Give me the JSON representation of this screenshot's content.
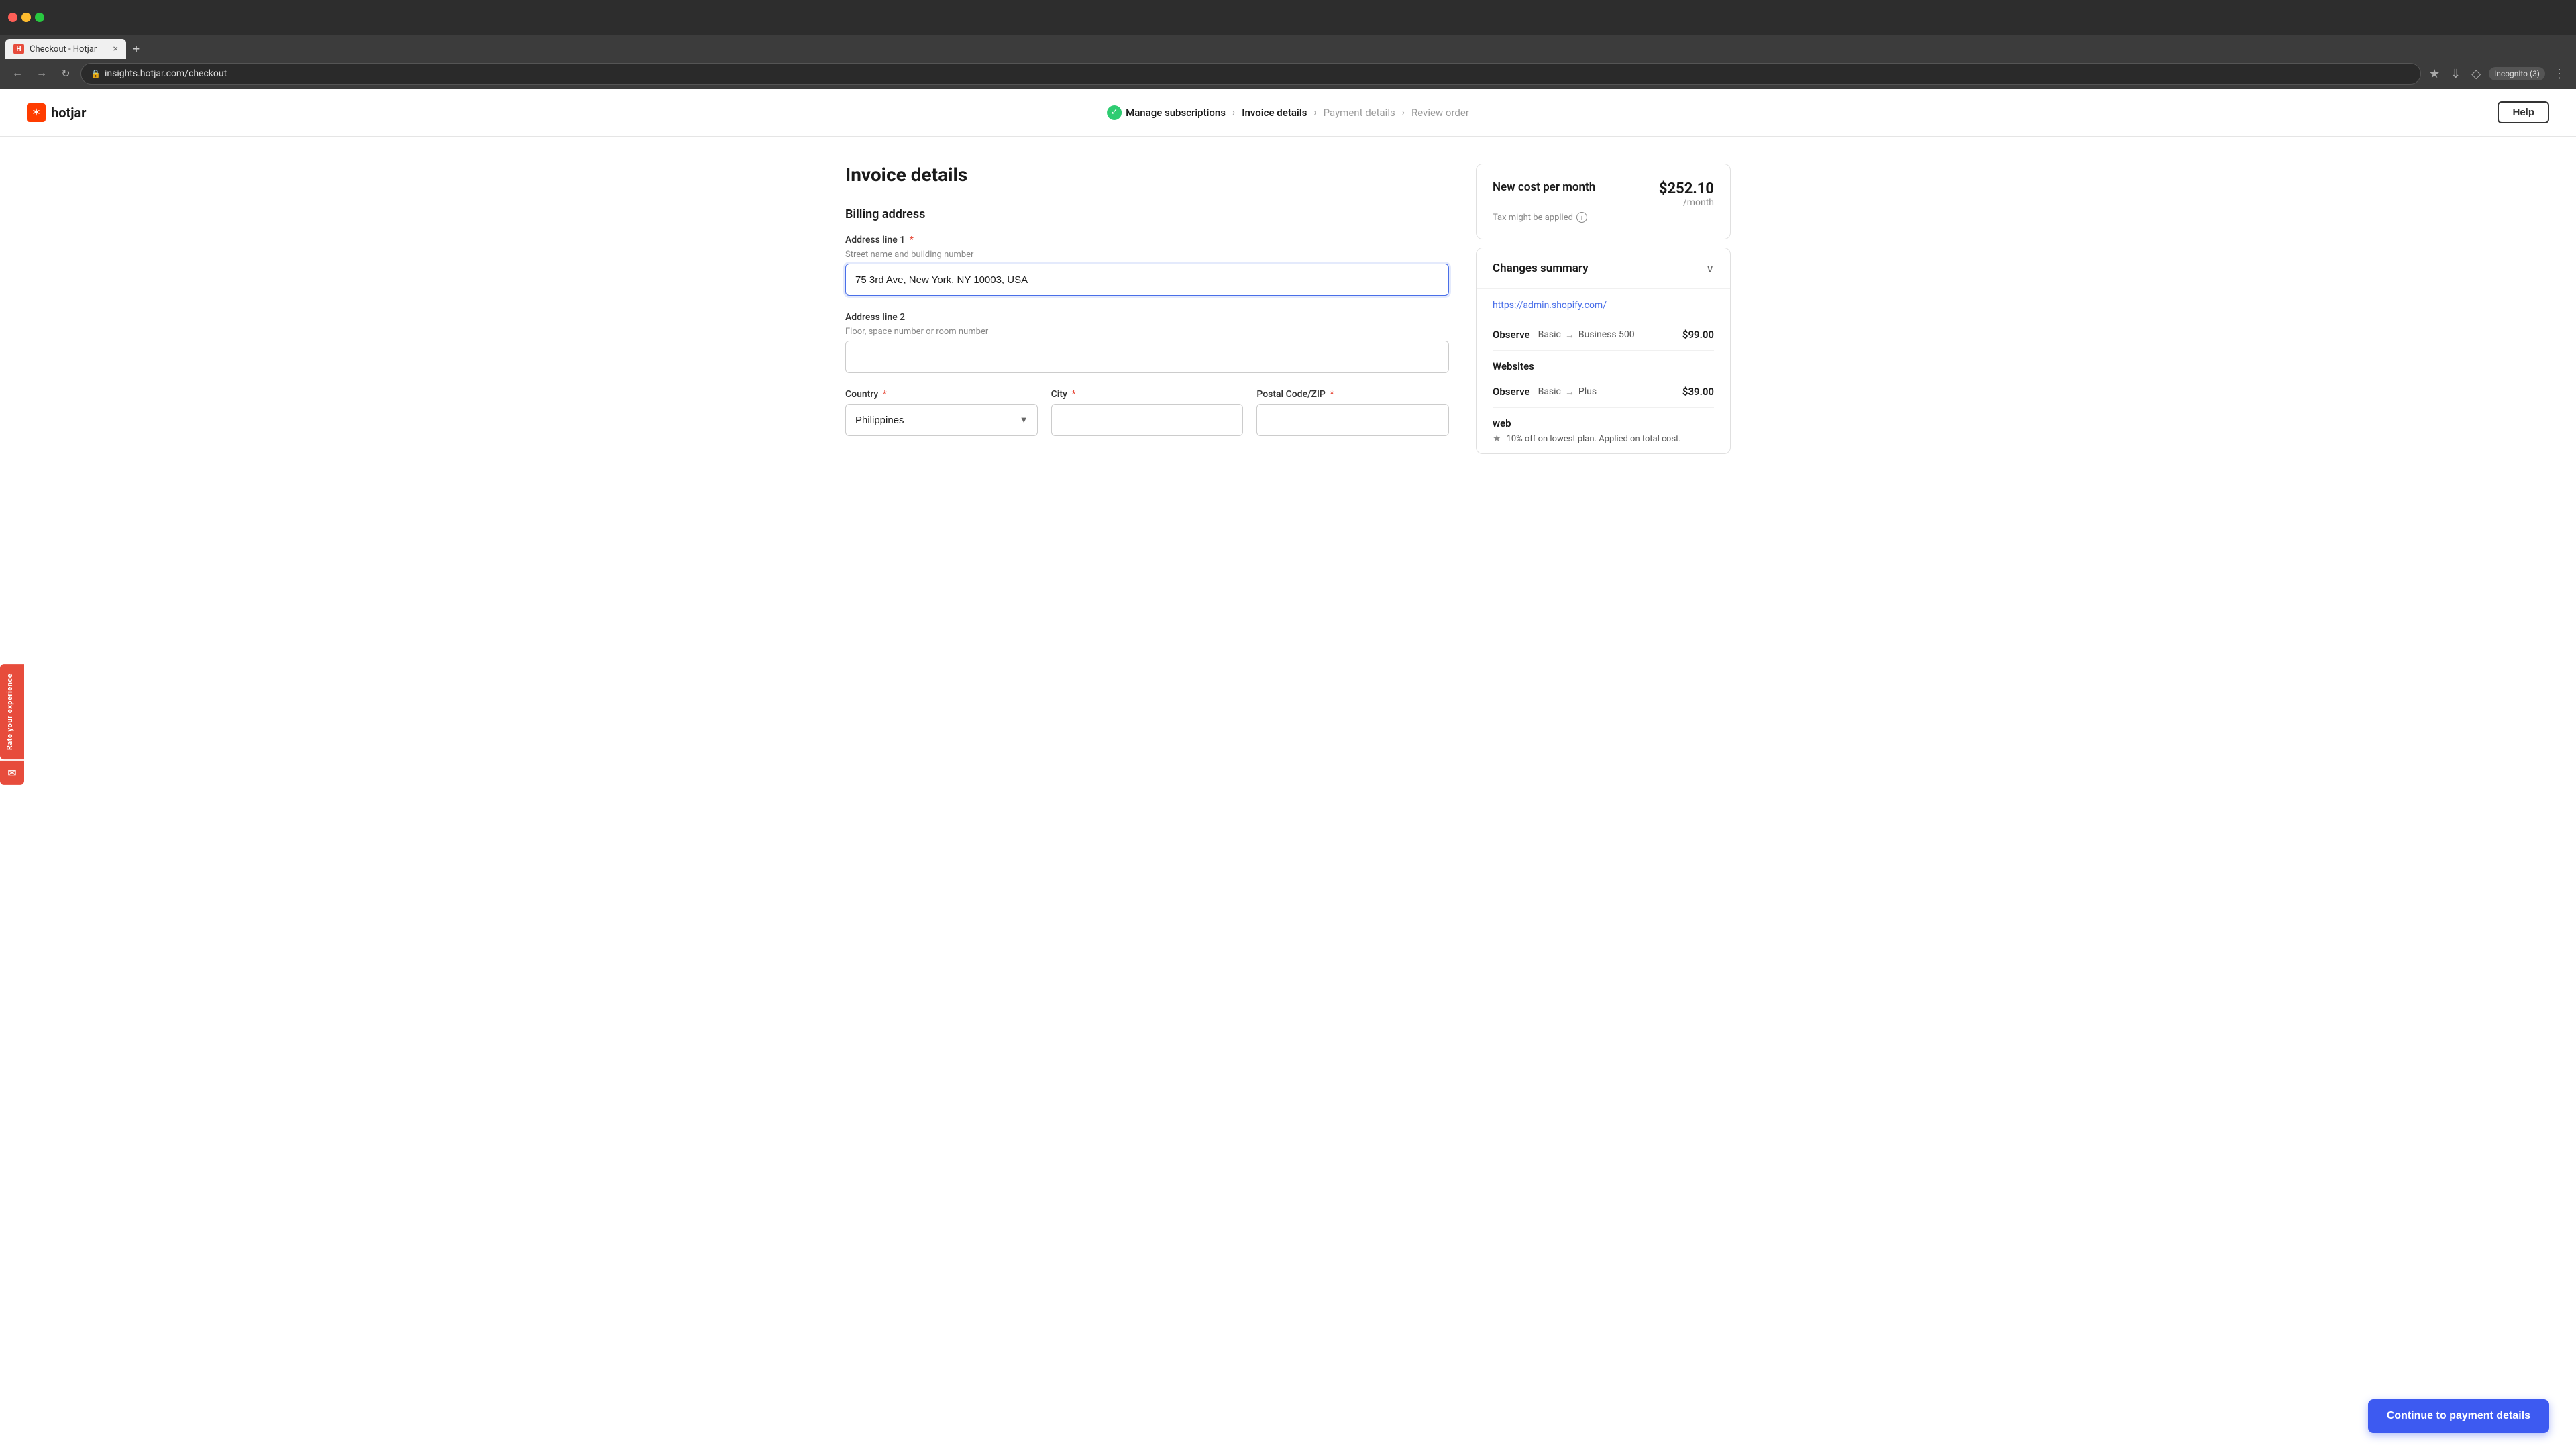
{
  "browser": {
    "tab_favicon": "H",
    "tab_title": "Checkout - Hotjar",
    "tab_close": "×",
    "new_tab": "+",
    "back_btn": "←",
    "forward_btn": "→",
    "refresh_btn": "↻",
    "address_url": "insights.hotjar.com/checkout",
    "incognito_label": "Incognito (3)",
    "window_controls": {
      "min": "_",
      "max": "□",
      "close": "×"
    }
  },
  "header": {
    "logo_text": "hotjar",
    "help_label": "Help",
    "breadcrumbs": [
      {
        "id": "manage",
        "label": "Manage subscriptions",
        "state": "completed"
      },
      {
        "id": "invoice",
        "label": "Invoice details",
        "state": "active"
      },
      {
        "id": "payment",
        "label": "Payment details",
        "state": "inactive"
      },
      {
        "id": "review",
        "label": "Review order",
        "state": "inactive"
      }
    ]
  },
  "page": {
    "title": "Invoice details",
    "billing_section_title": "Billing address",
    "fields": {
      "address1": {
        "label": "Address line 1",
        "hint": "Street name and building number",
        "value": "75 3rd Ave, New York, NY 10003, USA",
        "placeholder": ""
      },
      "address2": {
        "label": "Address line 2",
        "hint": "Floor, space number or room number",
        "value": "",
        "placeholder": ""
      },
      "country": {
        "label": "Country",
        "value": "Philippines"
      },
      "city": {
        "label": "City",
        "value": ""
      },
      "postal": {
        "label": "Postal Code/ZIP",
        "value": ""
      }
    }
  },
  "sidebar": {
    "cost_card": {
      "label": "New cost per month",
      "amount": "$252.10",
      "per_month": "/month",
      "tax_note": "Tax might be applied"
    },
    "changes_summary": {
      "title": "Changes summary",
      "chevron": "∨",
      "site_url": "https://admin.shopify.com/",
      "items": [
        {
          "product": "Observe",
          "from": "Basic",
          "to": "Business 500",
          "price": "$99.00"
        }
      ],
      "websites_title": "Websites",
      "website_items": [
        {
          "product": "Observe",
          "from": "Basic",
          "to": "Plus",
          "price": "$39.00"
        }
      ],
      "website_name": "web",
      "discount_text": "10% off on lowest plan. Applied on total cost."
    }
  },
  "continue_btn_label": "Continue to payment details",
  "feedback": {
    "label": "Rate your experience",
    "emoji": "📧"
  }
}
